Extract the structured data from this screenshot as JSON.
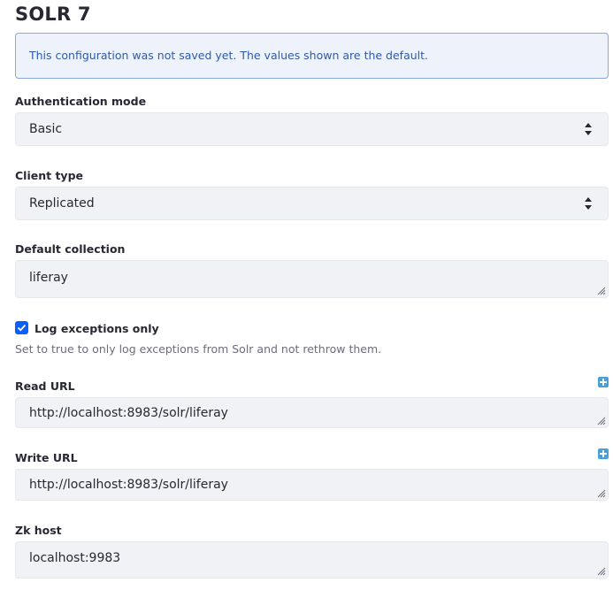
{
  "title": "SOLR 7",
  "alert": {
    "message": "This configuration was not saved yet. The values shown are the default."
  },
  "fields": {
    "auth_mode": {
      "label": "Authentication mode",
      "value": "Basic"
    },
    "client_type": {
      "label": "Client type",
      "value": "Replicated"
    },
    "default_collection": {
      "label": "Default collection",
      "value": "liferay"
    },
    "log_exceptions": {
      "label": "Log exceptions only",
      "checked": true,
      "help": "Set to true to only log exceptions from Solr and not rethrow them."
    },
    "read_url": {
      "label": "Read URL",
      "value": "http://localhost:8983/solr/liferay"
    },
    "write_url": {
      "label": "Write URL",
      "value": "http://localhost:8983/solr/liferay"
    },
    "zk_host": {
      "label": "Zk host",
      "value": "localhost:9983"
    }
  },
  "colors": {
    "accent": "#0b5fff",
    "alert_bg": "#eef2fa",
    "alert_border": "#89a7e0",
    "alert_text": "#2e5aac",
    "field_bg": "#f1f2f5",
    "add_icon": "#4b9fd8"
  }
}
